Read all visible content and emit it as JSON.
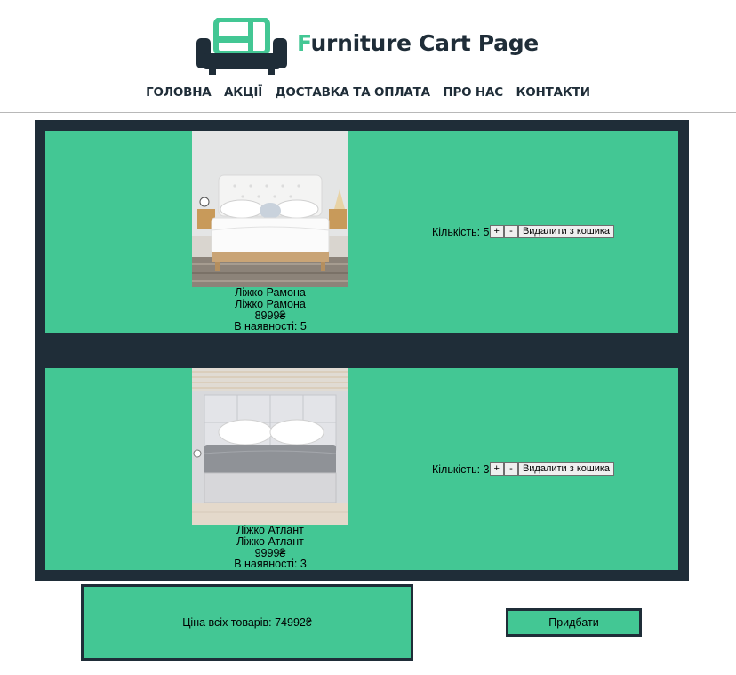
{
  "header": {
    "brand_first": "F",
    "brand_rest": "urniture Cart Page",
    "logo_icon": "sofa-logo-icon",
    "nav": [
      "ГОЛОВНА",
      "АКЦІЇ",
      "ДОСТАВКА ТА ОПЛАТА",
      "ПРО НАС",
      "КОНТАКТИ"
    ]
  },
  "cart": {
    "items": [
      {
        "image": "bed-photo-white-tufted",
        "name": "Ліжко Рамона",
        "description": "Ліжко Рамона",
        "price": "8999₴",
        "stock": "В наявності: 5",
        "quantity": "Кількість: 5",
        "plus": "+",
        "minus": "-",
        "remove": "Видалити з кошика"
      },
      {
        "image": "bed-photo-grey-upholstered",
        "name": "Ліжко Атлант",
        "description": "Ліжко Атлант",
        "price": "9999₴",
        "stock": "В наявності: 3",
        "quantity": "Кількість: 3",
        "plus": "+",
        "minus": "-",
        "remove": "Видалити з кошика"
      }
    ]
  },
  "summary": {
    "total": "Ціна всіх товарів: 74992₴",
    "buy_label": "Придбати"
  },
  "colors": {
    "accent": "#43c794",
    "dark": "#1f2d38"
  }
}
